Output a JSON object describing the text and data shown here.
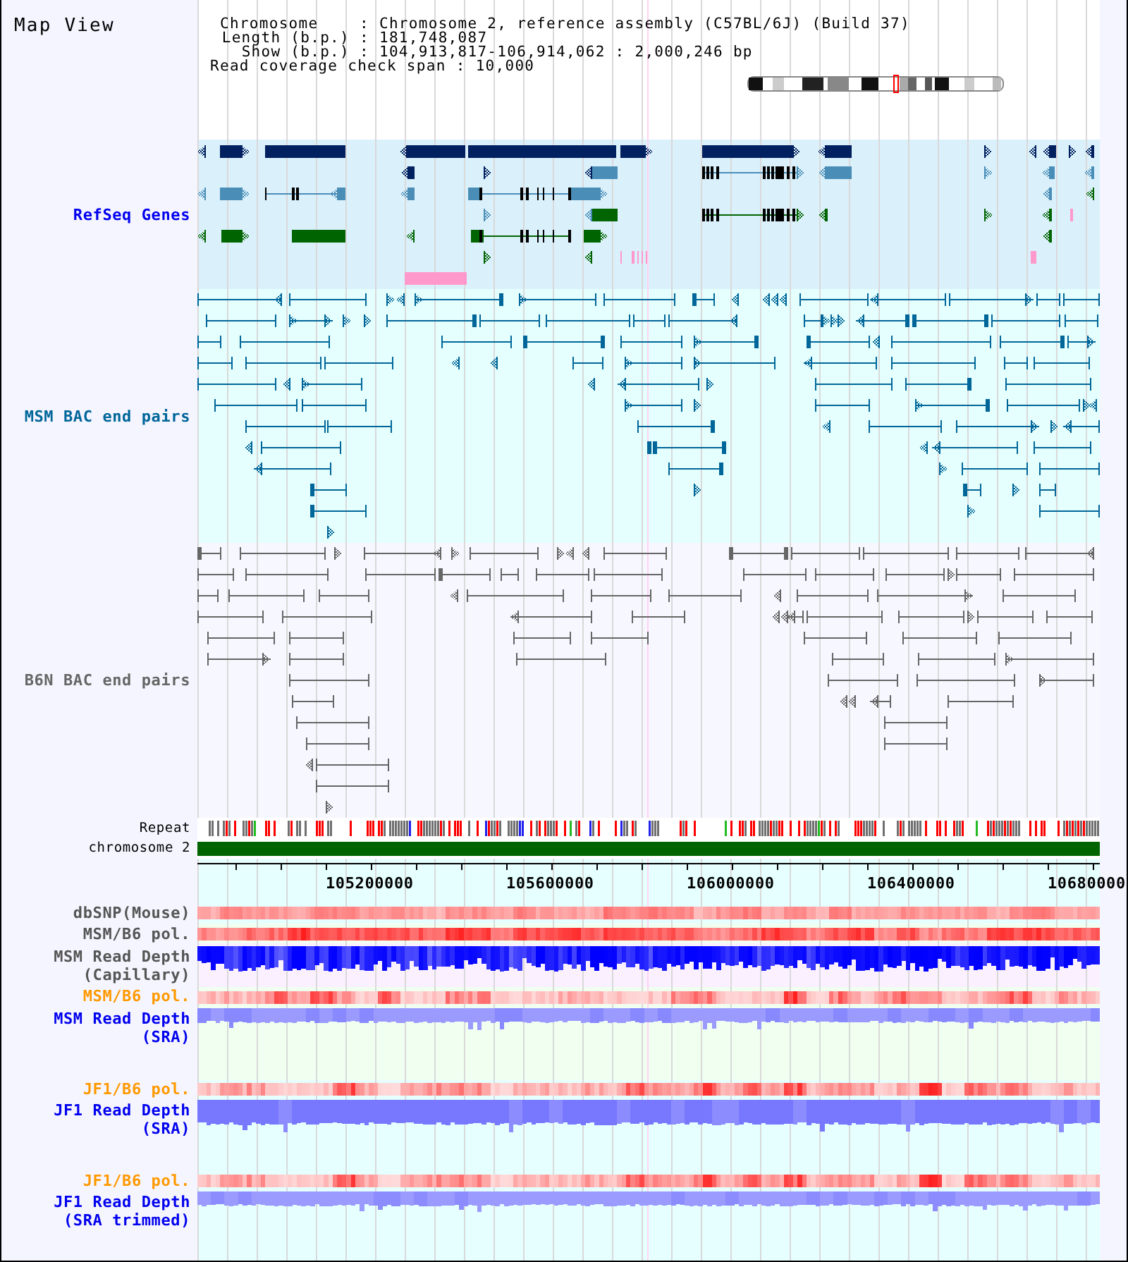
{
  "title": "Map View",
  "header": {
    "rows": [
      {
        "label": "Chromosome",
        "separator": ":",
        "value": "Chromosome 2, reference assembly (C57BL/6J) (Build 37)"
      },
      {
        "label": "Length (b.p.)",
        "separator": ":",
        "value": "181,748,087"
      },
      {
        "label": "Show (b.p.)",
        "separator": ":",
        "value": "104,913,817-106,914,062 : 2,000,246 bp"
      },
      {
        "label": "Read coverage check span",
        "separator": ":",
        "value": "10,000"
      }
    ]
  },
  "tracks": [
    {
      "kind": "genes",
      "label": "RefSeq Genes",
      "color": "#0000ee"
    },
    {
      "kind": "bac_pairs",
      "label": "MSM BAC end pairs",
      "color": "#006699"
    },
    {
      "kind": "bac_pairs",
      "label": "B6N BAC end pairs",
      "color": "#666666"
    },
    {
      "kind": "repeat",
      "label": "Repeat",
      "color": "#000000"
    },
    {
      "kind": "chromosome",
      "label": "chromosome 2",
      "color": "#000000"
    },
    {
      "kind": "axis",
      "labels": [
        "105200000",
        "105600000",
        "106000000",
        "106400000",
        "10680000"
      ]
    },
    {
      "kind": "heat",
      "label": "dbSNP(Mouse)",
      "color": "#555555"
    },
    {
      "kind": "heat",
      "label": "MSM/B6 pol.",
      "color": "#555555"
    },
    {
      "kind": "depth",
      "label": "MSM Read Depth (Capillary)",
      "color": "#555555"
    },
    {
      "kind": "heat",
      "label": "MSM/B6 pol.",
      "color": "#ff9900"
    },
    {
      "kind": "depth",
      "label": "MSM Read Depth (SRA)",
      "color": "#0000ee"
    },
    {
      "kind": "heat",
      "label": "JF1/B6 pol.",
      "color": "#ff9900"
    },
    {
      "kind": "depth",
      "label": "JF1 Read Depth (SRA)",
      "color": "#0000ee"
    },
    {
      "kind": "heat",
      "label": "JF1/B6 pol.",
      "color": "#ff9900"
    },
    {
      "kind": "depth",
      "label": "JF1 Read Depth (SRA trimmed)",
      "color": "#0000ee"
    }
  ]
}
